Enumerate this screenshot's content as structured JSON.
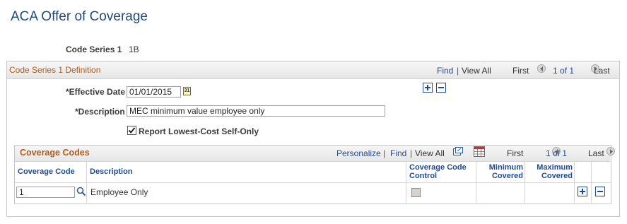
{
  "page": {
    "title": "ACA Offer of Coverage",
    "code_series_label": "Code Series 1",
    "code_series_value": "1B"
  },
  "definition": {
    "title": "Code Series 1 Definition",
    "nav": {
      "find": "Find",
      "sep": "|",
      "view_all": "View All",
      "first": "First",
      "count": "1 of 1",
      "last": "Last"
    },
    "effective_date_label": "*Effective Date",
    "effective_date_value": "01/01/2015",
    "calendar_icon_text": "31",
    "description_label": "*Description",
    "description_value": "MEC minimum value employee only",
    "report_lowest_label": "Report Lowest-Cost Self-Only",
    "report_lowest_checked": true
  },
  "coverage_codes": {
    "title": "Coverage Codes",
    "nav": {
      "personalize": "Personalize",
      "sep": "|",
      "find": "Find",
      "view_all": "View All",
      "first": "First",
      "count": "1 of 1",
      "last": "Last"
    },
    "columns": {
      "coverage_code": "Coverage Code",
      "description": "Description",
      "control_line1": "Coverage Code",
      "control_line2": "Control",
      "minimum_line1": "Minimum",
      "minimum_line2": "Covered",
      "maximum_line1": "Maximum",
      "maximum_line2": "Covered"
    },
    "rows": [
      {
        "coverage_code": "1",
        "description": "Employee Only",
        "control_checked": false,
        "minimum": "",
        "maximum": ""
      }
    ]
  },
  "colors": {
    "title_blue": "#1f4b7a",
    "link_blue": "#1f4b96",
    "section_orange": "#b45b1c"
  }
}
